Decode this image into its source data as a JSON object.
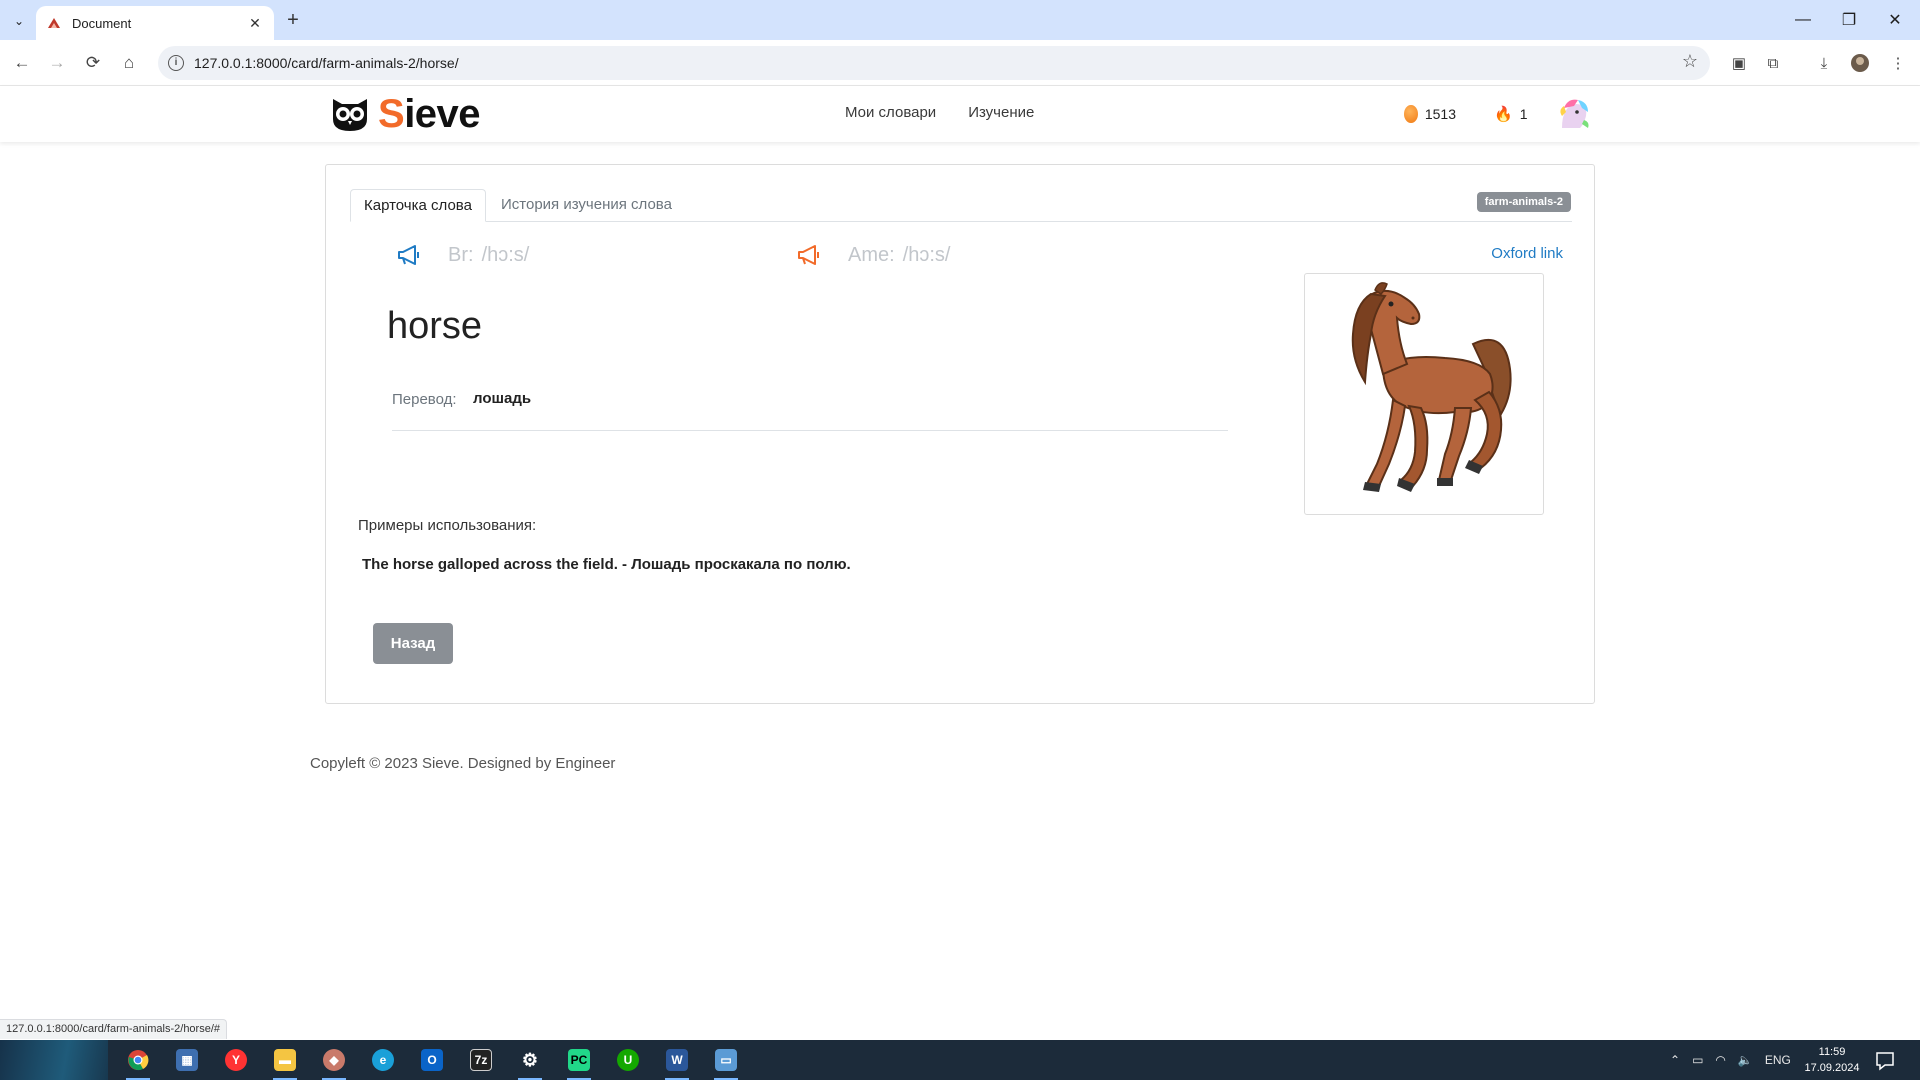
{
  "browser": {
    "tab_title": "Document",
    "url": "127.0.0.1:8000/card/farm-animals-2/horse/",
    "status_url": "127.0.0.1:8000/card/farm-animals-2/horse/#"
  },
  "header": {
    "logo_first": "S",
    "logo_rest": "ieve",
    "nav": [
      "Мои словари",
      "Изучение"
    ],
    "coins": "1513",
    "streak": "1"
  },
  "card": {
    "tabs": [
      "Карточка слова",
      "История изучения слова"
    ],
    "badge": "farm-animals-2",
    "br_label": "Br:",
    "br_ipa": "/hɔ:s/",
    "ame_label": "Ame:",
    "ame_ipa": "/hɔ:s/",
    "oxford_link": "Oxford link",
    "word": "horse",
    "translation_label": "Перевод:",
    "translation_value": "лошадь",
    "examples_label": "Примеры использования:",
    "example": "The horse galloped across the field. - Лошадь проскакала по полю.",
    "back_button": "Назад"
  },
  "footer": {
    "text": "Copyleft © 2023 Sieve. Designed by Engineer"
  },
  "taskbar": {
    "lang": "ENG",
    "time": "11:59",
    "date": "17.09.2024"
  },
  "colors": {
    "accent_orange": "#f26b2a",
    "link_blue": "#1f7bc4",
    "badge_gray": "#8a8f95"
  }
}
